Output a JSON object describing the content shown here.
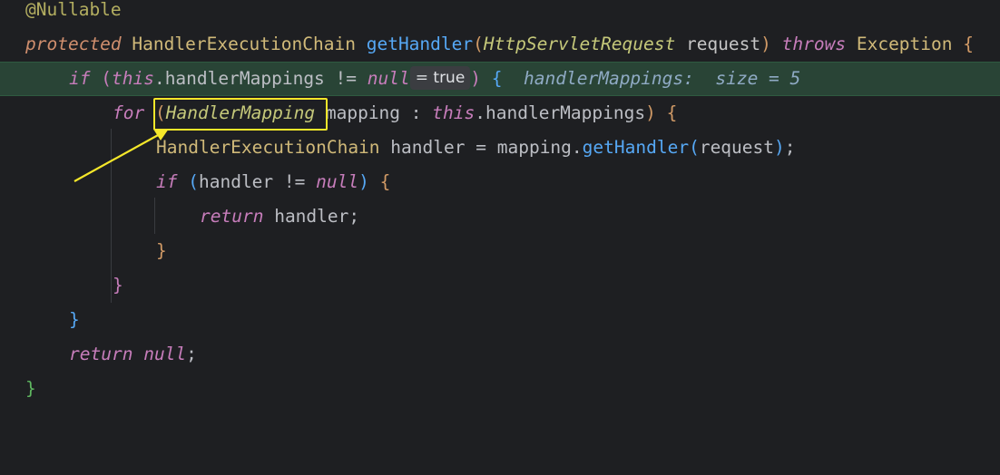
{
  "code": {
    "annotation": "@Nullable",
    "kw_protected": "protected",
    "type_hec": "HandlerExecutionChain",
    "method_getHandler": "getHandler",
    "param_type": "HttpServletRequest",
    "param_name": "request",
    "kw_throws": "throws",
    "exception": "Exception",
    "kw_if": "if",
    "kw_this": "this",
    "field_handlerMappings": ".handlerMappings",
    "op_neq": "!=",
    "kw_null": "null",
    "debug_value": "= true",
    "inline_hint": "handlerMappings:  size = 5",
    "kw_for": "for",
    "type_handlerMapping": "HandlerMapping",
    "var_mapping": "mapping",
    "colon": ":",
    "var_handler": "handler",
    "assign": "=",
    "call_mapping": "mapping",
    "call_getHandler": "getHandler",
    "arg_request": "request",
    "kw_return": "return",
    "semicolon": ";",
    "brace_open": "{",
    "brace_close": "}"
  },
  "colors": {
    "background": "#1e1f22",
    "execution_line": "#294436",
    "highlight_box": "#f5e72a",
    "arrow": "#f5e72a"
  }
}
